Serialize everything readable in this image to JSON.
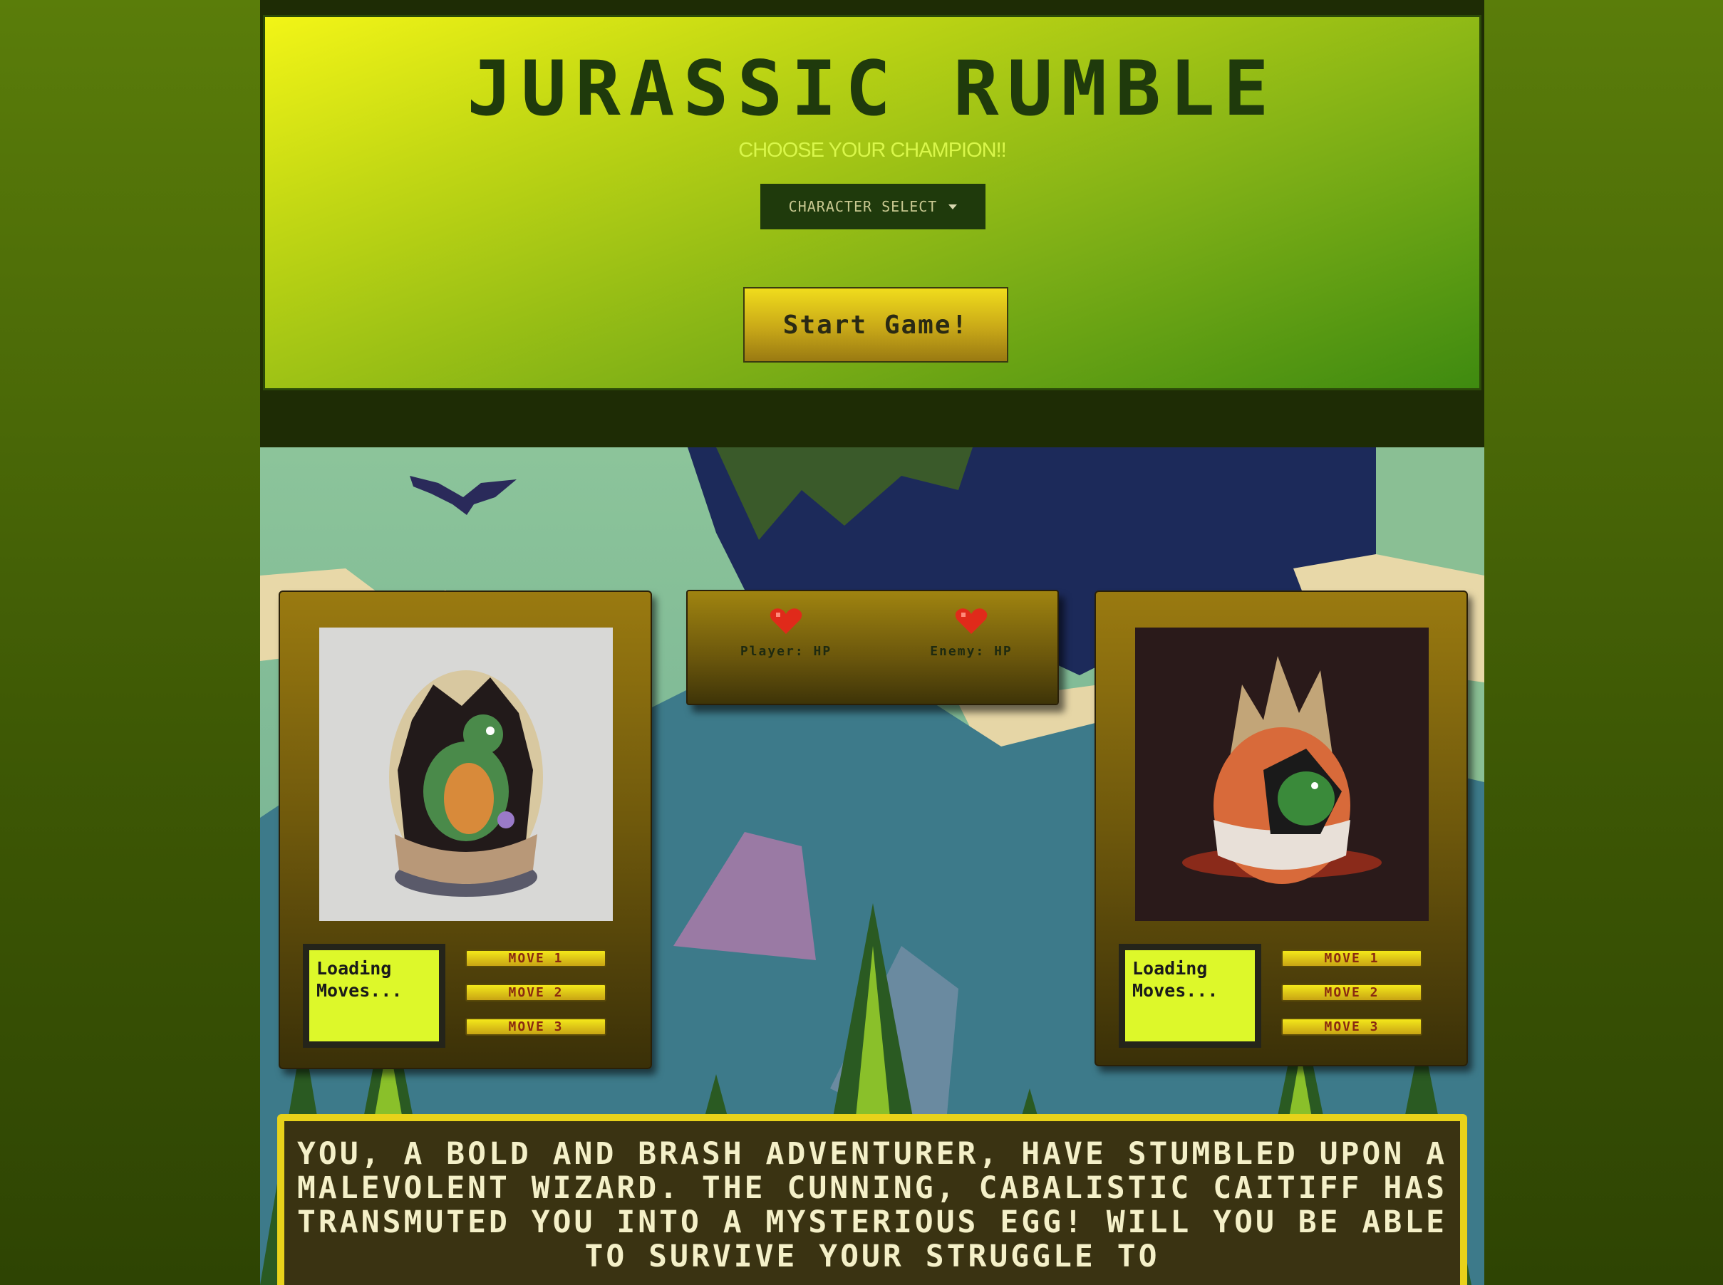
{
  "header": {
    "title": "JURASSIC RUMBLE",
    "subtitle": "CHOOSE YOUR CHAMPION!!",
    "character_select_label": "CHARACTER SELECT",
    "start_button_label": "Start Game!"
  },
  "player_card": {
    "status_text": "Loading Moves...",
    "moves": [
      "MOVE 1",
      "MOVE 2",
      "MOVE 3"
    ]
  },
  "enemy_card": {
    "status_text": "Loading Moves...",
    "moves": [
      "MOVE 1",
      "MOVE 2",
      "MOVE 3"
    ]
  },
  "hp_panel": {
    "player_label": "Player: HP",
    "enemy_label": "Enemy: HP"
  },
  "story": {
    "text": "YOU, A BOLD AND BRASH ADVENTURER, HAVE STUMBLED UPON A MALEVOLENT WIZARD. THE CUNNING, CABALISTIC CAITIFF HAS TRANSMUTED YOU INTO A MYSTERIOUS EGG! WILL YOU BE ABLE TO SURVIVE YOUR STRUGGLE TO"
  },
  "colors": {
    "accent_lime": "#ddf82a",
    "card_gold": "#9a7a10",
    "title_dark_green": "#1f3a0c",
    "move_text_red": "#8a2a10",
    "heart_red": "#e02a1a"
  },
  "icons": [
    "heart-icon",
    "chevron-down-icon"
  ]
}
